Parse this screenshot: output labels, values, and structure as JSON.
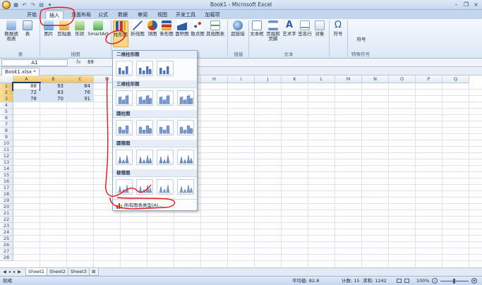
{
  "window": {
    "title": "Book1 - Microsoft Excel"
  },
  "tabs": [
    {
      "label": "开始",
      "active": false
    },
    {
      "label": "插入",
      "active": true
    },
    {
      "label": "页面布局",
      "active": false
    },
    {
      "label": "公式",
      "active": false
    },
    {
      "label": "数据",
      "active": false
    },
    {
      "label": "审阅",
      "active": false
    },
    {
      "label": "视图",
      "active": false
    },
    {
      "label": "开发工具",
      "active": false
    },
    {
      "label": "加载项",
      "active": false
    }
  ],
  "ribbon": {
    "table_group": {
      "label": "表",
      "buttons": [
        "数据透视表",
        "表"
      ]
    },
    "illustrations_group": {
      "label": "插图",
      "buttons": [
        "图片",
        "剪贴画",
        "形状",
        "SmartArt"
      ]
    },
    "charts_group": {
      "buttons": [
        "柱形图",
        "折线图",
        "饼图",
        "条形图",
        "面积图",
        "散点图",
        "其他图表"
      ]
    },
    "links_group": {
      "label": "链接",
      "buttons": [
        "超链接"
      ]
    },
    "text_group": {
      "label": "文本",
      "buttons": [
        "文本框",
        "页眉和页脚",
        "艺术字",
        "签名行",
        "对象"
      ]
    },
    "symbols_group": {
      "label": "特殊符号",
      "buttons": [
        "符号",
        "符号"
      ]
    }
  },
  "formula_bar": {
    "name_box": "A1",
    "fx_label": "fx",
    "formula": "88"
  },
  "document_tab": "Book1.xlsx *",
  "grid": {
    "columns": [
      "A",
      "B",
      "C",
      "D",
      "E",
      "F",
      "G",
      "H",
      "I",
      "J",
      "K",
      "L",
      "M",
      "N",
      "O",
      "P",
      "Q"
    ],
    "rows": [
      "1",
      "2",
      "3",
      "4",
      "5",
      "6",
      "7",
      "8",
      "9",
      "10",
      "11",
      "12",
      "13",
      "14",
      "15",
      "16",
      "17",
      "18",
      "19",
      "20",
      "21",
      "22",
      "23",
      "24",
      "25",
      "26",
      "27",
      "28"
    ],
    "data": [
      [
        "88",
        "93",
        "84"
      ],
      [
        "72",
        "83",
        "76"
      ],
      [
        "78",
        "70",
        "91"
      ]
    ]
  },
  "sheets": [
    "Sheet1",
    "Sheet2",
    "Sheet3"
  ],
  "status": {
    "ready": "就绪",
    "average": "平均值: 82.8",
    "count": "计数: 15",
    "sum": "求和: 1242",
    "zoom": "100%"
  },
  "chart_menu": {
    "sections": [
      "二维柱形图",
      "三维柱形图",
      "圆柱图",
      "圆锥图",
      "棱锥图"
    ],
    "footer": "所有图表类型(A)..."
  }
}
